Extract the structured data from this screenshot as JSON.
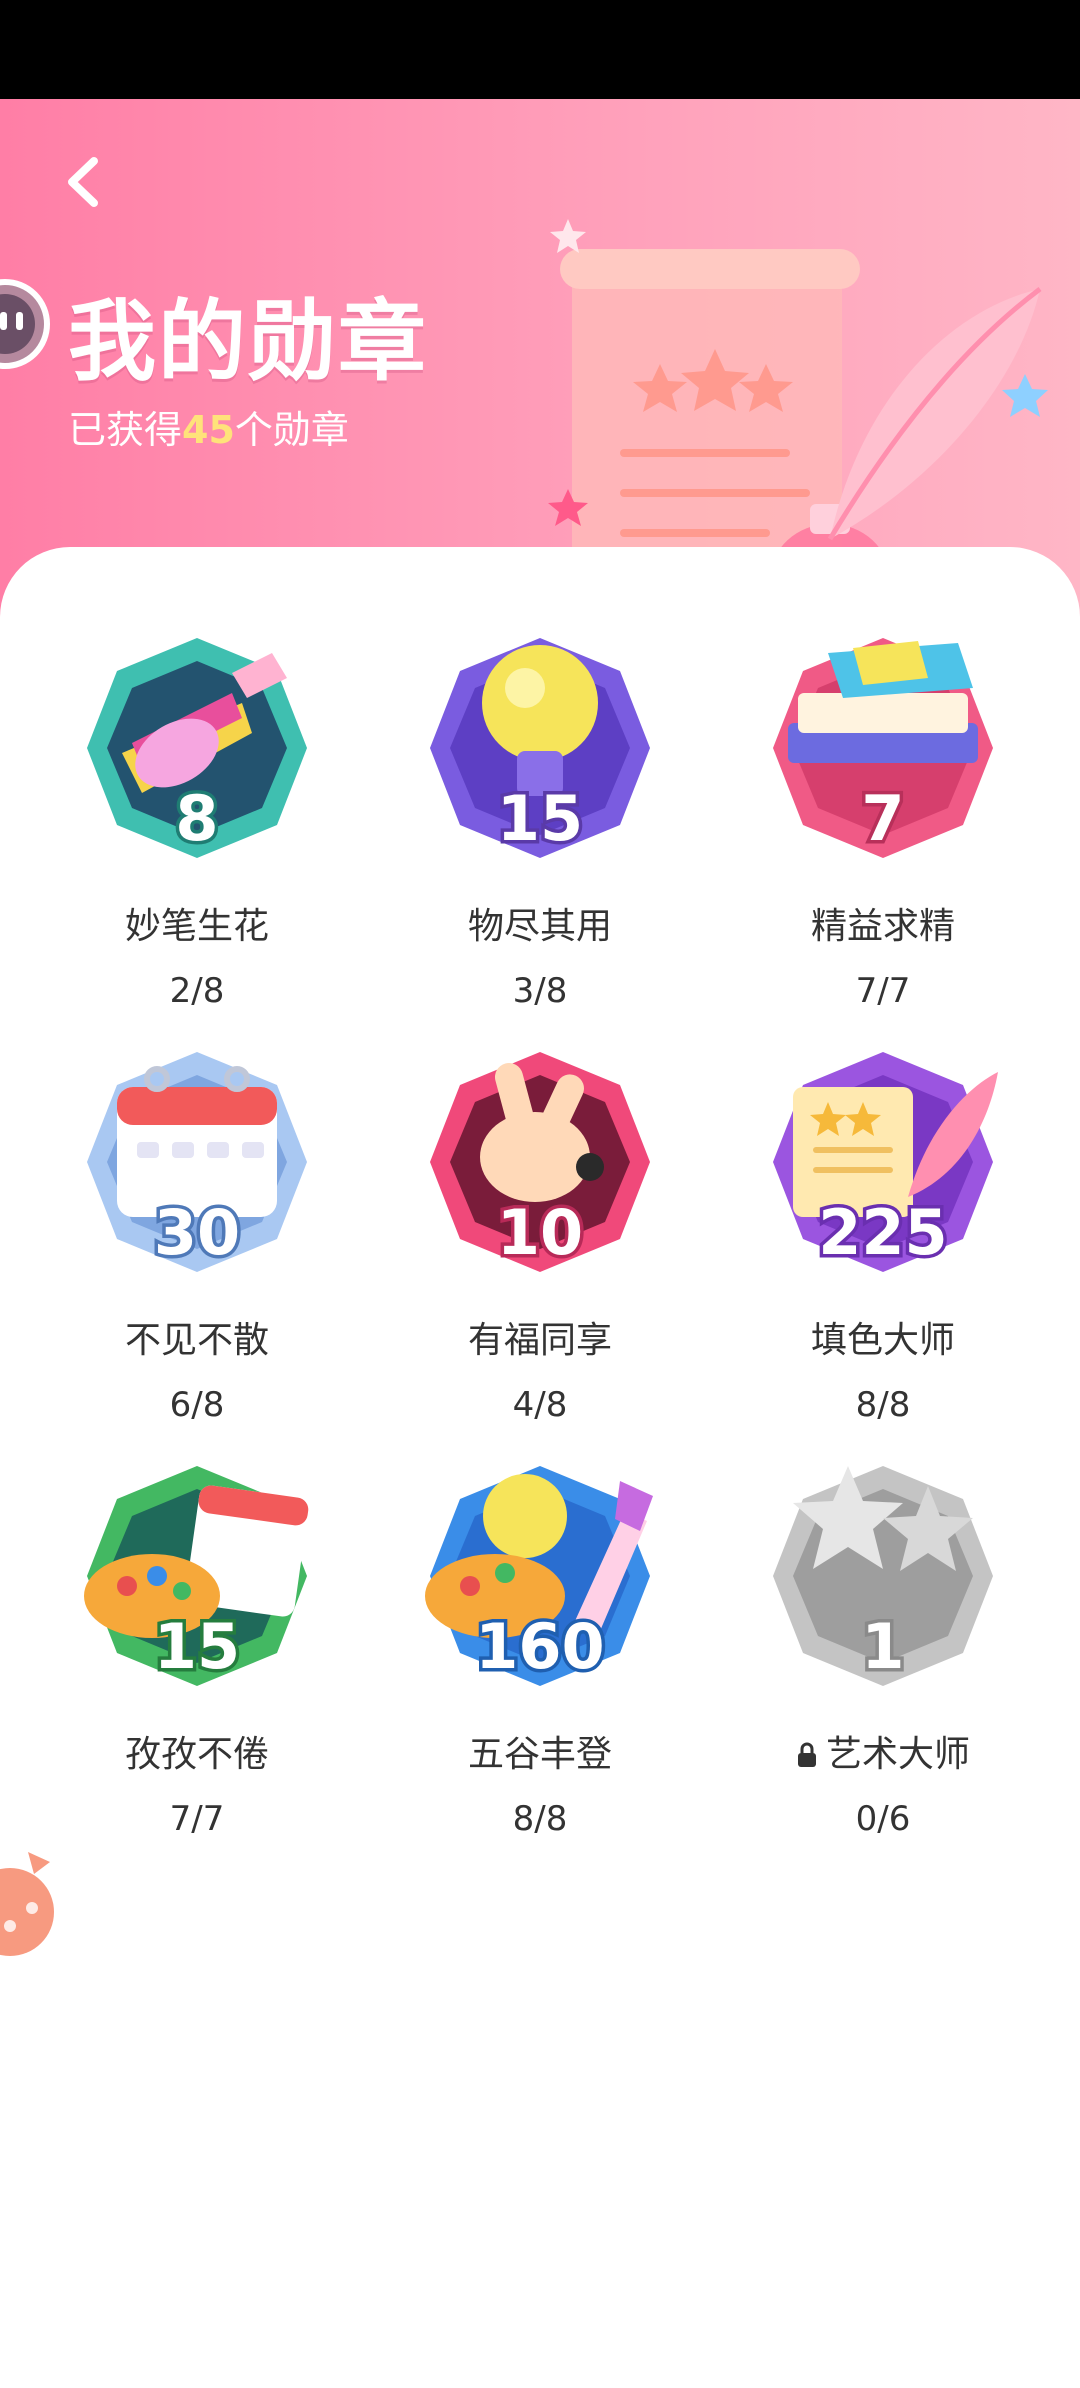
{
  "header": {
    "title": "我的勋章",
    "summary_prefix": "已获得",
    "summary_count": "45",
    "summary_suffix": "个勋章",
    "back_icon": "chevron-left-icon"
  },
  "badges": [
    {
      "name": "妙笔生花",
      "progress": "2/8",
      "level": "8",
      "icon": "paintbrush-icon",
      "color": "#3fbfb0",
      "stroke": "#1f7d73"
    },
    {
      "name": "物尽其用",
      "progress": "3/8",
      "level": "15",
      "icon": "lightbulb-icon",
      "color": "#7a5ce0",
      "stroke": "#5a3aa8"
    },
    {
      "name": "精益求精",
      "progress": "7/7",
      "level": "7",
      "icon": "books-icon",
      "color": "#f05a86",
      "stroke": "#b8305a"
    },
    {
      "name": "不见不散",
      "progress": "6/8",
      "level": "30",
      "icon": "calendar-icon",
      "color": "#8fb6ee",
      "stroke": "#4f79b8"
    },
    {
      "name": "有福同享",
      "progress": "4/8",
      "level": "10",
      "icon": "hand-gesture-icon",
      "color": "#f0497a",
      "stroke": "#b82a58"
    },
    {
      "name": "填色大师",
      "progress": "8/8",
      "level": "225",
      "icon": "scroll-feather-icon",
      "color": "#9b55e0",
      "stroke": "#6a2fb0"
    },
    {
      "name": "孜孜不倦",
      "progress": "7/7",
      "level": "15",
      "icon": "palette-calendar-icon",
      "color": "#43b862",
      "stroke": "#257d3e"
    },
    {
      "name": "五谷丰登",
      "progress": "8/8",
      "level": "160",
      "icon": "palette-brush-icon",
      "color": "#3a8de8",
      "stroke": "#1f5fb0"
    },
    {
      "name": "艺术大师",
      "progress": "0/6",
      "level": "1",
      "icon": "flower-stars-icon",
      "color": "#bdbdbd",
      "stroke": "#8a8a8a",
      "locked": true
    }
  ],
  "colors": {
    "header_gradient_start": "#ff7ea6",
    "header_gradient_end": "#ffb6c6",
    "summary_count": "#ffe27a",
    "text": "#333333"
  }
}
